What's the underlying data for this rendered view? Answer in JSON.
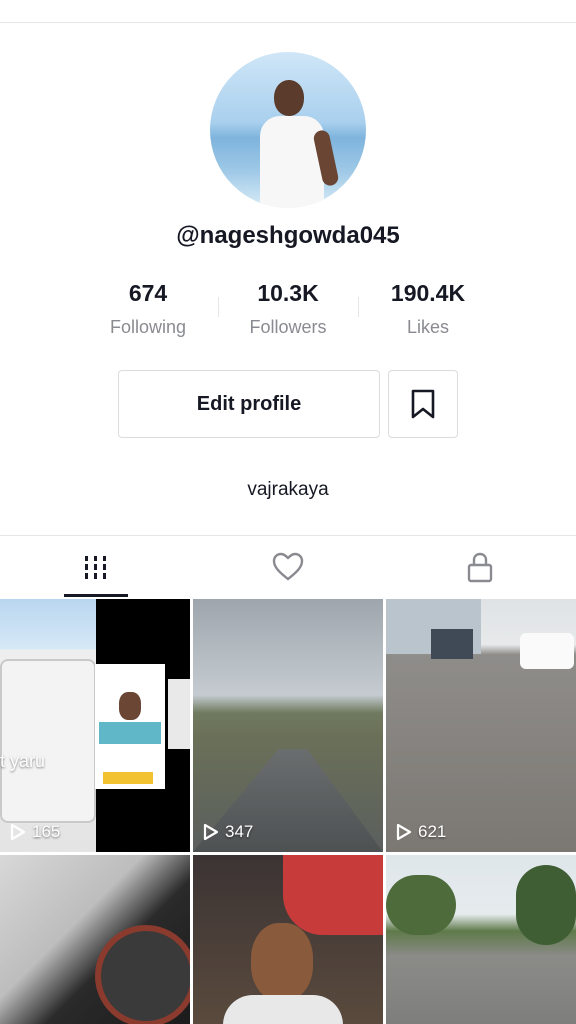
{
  "profile": {
    "username": "@nageshgowda045",
    "bio": "vajrakaya",
    "stats": [
      {
        "value": "674",
        "label": "Following"
      },
      {
        "value": "10.3K",
        "label": "Followers"
      },
      {
        "value": "190.4K",
        "label": "Likes"
      }
    ],
    "edit_label": "Edit profile"
  },
  "tabs": [
    {
      "icon": "grid-icon",
      "selected": true
    },
    {
      "icon": "heart-icon",
      "selected": false
    },
    {
      "icon": "lock-icon",
      "selected": false
    }
  ],
  "videos": [
    {
      "views": "165",
      "overlay": "t yaru"
    },
    {
      "views": "347"
    },
    {
      "views": "621"
    },
    {
      "views": ""
    },
    {
      "views": ""
    },
    {
      "views": ""
    }
  ],
  "colors": {
    "text": "#161823",
    "muted": "#8a8b91",
    "border": "#e6e6e6"
  }
}
